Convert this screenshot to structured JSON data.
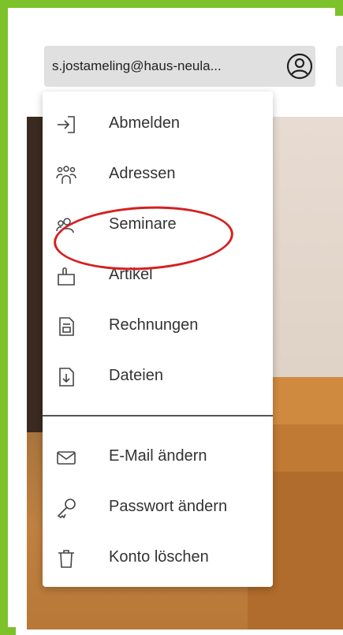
{
  "user": {
    "email": "s.jostameling@haus-neula..."
  },
  "menu": {
    "items": [
      {
        "label": "Abmelden",
        "icon": "logout-icon"
      },
      {
        "label": "Adressen",
        "icon": "people-group-icon"
      },
      {
        "label": "Seminare",
        "icon": "people-icon"
      },
      {
        "label": "Artikel",
        "icon": "bag-icon"
      },
      {
        "label": "Rechnungen",
        "icon": "invoice-icon"
      },
      {
        "label": "Dateien",
        "icon": "file-download-icon"
      }
    ],
    "account_items": [
      {
        "label": "E-Mail ändern",
        "icon": "mail-icon"
      },
      {
        "label": "Passwort ändern",
        "icon": "key-icon"
      },
      {
        "label": "Konto löschen",
        "icon": "trash-icon"
      }
    ]
  },
  "colors": {
    "frame": "#7dc22a",
    "highlight": "#d42020"
  }
}
